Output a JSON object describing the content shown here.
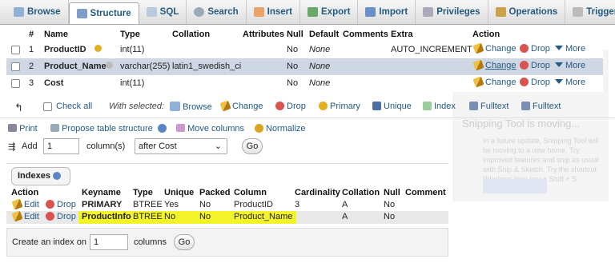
{
  "tabs": [
    {
      "label": "Browse",
      "icon": "browse-icon"
    },
    {
      "label": "Structure",
      "icon": "structure-icon"
    },
    {
      "label": "SQL",
      "icon": "sql-icon"
    },
    {
      "label": "Search",
      "icon": "search-icon"
    },
    {
      "label": "Insert",
      "icon": "insert-icon"
    },
    {
      "label": "Export",
      "icon": "export-icon"
    },
    {
      "label": "Import",
      "icon": "import-icon"
    },
    {
      "label": "Privileges",
      "icon": "privileges-icon"
    },
    {
      "label": "Operations",
      "icon": "operations-icon"
    },
    {
      "label": "Triggers",
      "icon": "triggers-icon"
    }
  ],
  "columns_table": {
    "headers": [
      "#",
      "Name",
      "Type",
      "Collation",
      "Attributes",
      "Null",
      "Default",
      "Comments",
      "Extra",
      "Action"
    ],
    "rows": [
      {
        "num": "1",
        "name": "ProductID",
        "type": "int(11)",
        "collation": "",
        "null": "No",
        "default": "None",
        "extra": "AUTO_INCREMENT"
      },
      {
        "num": "2",
        "name": "Product_Name",
        "type": "varchar(255)",
        "collation": "latin1_swedish_ci",
        "null": "No",
        "default": "None",
        "extra": ""
      },
      {
        "num": "3",
        "name": "Cost",
        "type": "int(11)",
        "collation": "",
        "null": "No",
        "default": "None",
        "extra": ""
      }
    ],
    "actions": {
      "change": "Change",
      "drop": "Drop",
      "more": "More"
    }
  },
  "bulk": {
    "check_all": "Check all",
    "with_selected": "With selected:",
    "browse": "Browse",
    "change": "Change",
    "drop": "Drop",
    "primary": "Primary",
    "unique": "Unique",
    "index": "Index",
    "fulltext1": "Fulltext",
    "fulltext2": "Fulltext"
  },
  "tools": {
    "print": "Print",
    "propose": "Propose table structure",
    "move": "Move columns",
    "normalize": "Normalize"
  },
  "add_column": {
    "label": "Add",
    "count": "1",
    "unit": "column(s)",
    "position": "after Cost",
    "go": "Go"
  },
  "indexes": {
    "title": "Indexes",
    "headers": [
      "Action",
      "Keyname",
      "Type",
      "Unique",
      "Packed",
      "Column",
      "Cardinality",
      "Collation",
      "Null",
      "Comment"
    ],
    "rows": [
      {
        "edit": "Edit",
        "drop": "Drop",
        "keyname": "PRIMARY",
        "type": "BTREE",
        "unique": "Yes",
        "packed": "No",
        "column": "ProductID",
        "cardinality": "3",
        "collation": "A",
        "null": "No"
      },
      {
        "edit": "Edit",
        "drop": "Drop",
        "keyname": "ProductInfo",
        "type": "BTREE",
        "unique": "No",
        "packed": "No",
        "column": "Product_Name",
        "cardinality": "",
        "collation": "A",
        "null": "No"
      }
    ]
  },
  "create_index": {
    "label": "Create an index on",
    "count": "1",
    "unit": "columns",
    "go": "Go"
  },
  "ghost": {
    "title": "Snipping Tool is moving...",
    "body": "In a future update, Snipping Tool will be moving to a new home. Try improved features and snip as usual with Snip & Sketch. Try the shortcut Windows logo key + Shift + S"
  }
}
